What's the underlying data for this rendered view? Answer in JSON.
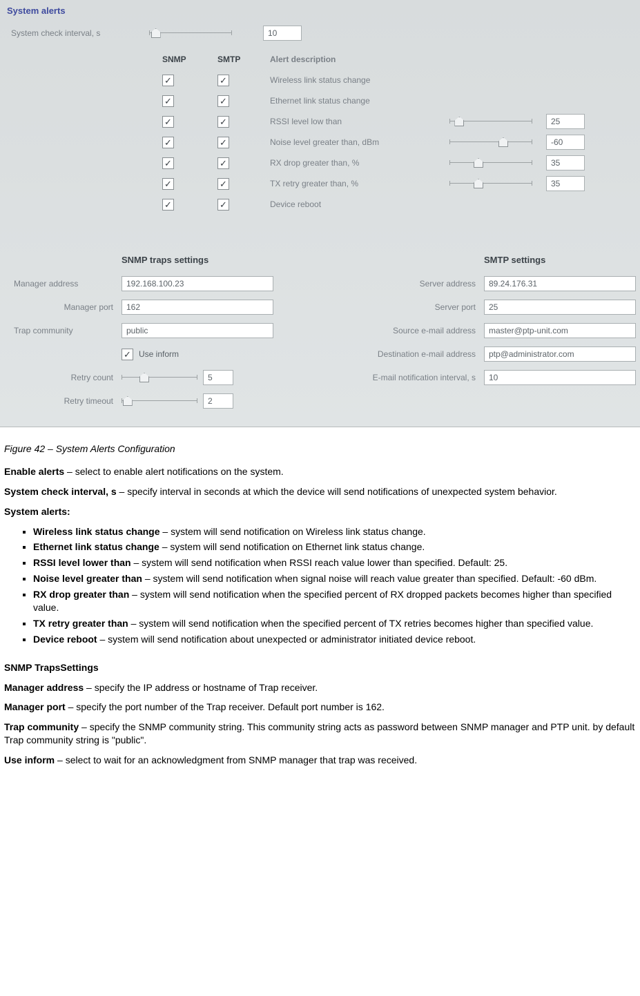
{
  "screenshot": {
    "section_title": "System alerts",
    "interval_label": "System check interval, s",
    "interval_value": "10",
    "headers": {
      "snmp": "SNMP",
      "smtp": "SMTP",
      "desc": "Alert description"
    },
    "alerts": [
      {
        "desc": "Wireless link status change",
        "snmp": true,
        "smtp": true
      },
      {
        "desc": "Ethernet link status change",
        "snmp": true,
        "smtp": true
      },
      {
        "desc": "RSSI level low than",
        "snmp": true,
        "smtp": true,
        "value": "25",
        "pos": 12
      },
      {
        "desc": "Noise level greater than, dBm",
        "snmp": true,
        "smtp": true,
        "value": "-60",
        "pos": 65
      },
      {
        "desc": "RX drop greater than, %",
        "snmp": true,
        "smtp": true,
        "value": "35",
        "pos": 35
      },
      {
        "desc": "TX retry greater than, %",
        "snmp": true,
        "smtp": true,
        "value": "35",
        "pos": 35
      },
      {
        "desc": "Device reboot",
        "snmp": true,
        "smtp": true
      }
    ],
    "snmp_traps": {
      "header": "SNMP traps settings",
      "manager_address_label": "Manager address",
      "manager_address_value": "192.168.100.23",
      "manager_port_label": "Manager port",
      "manager_port_value": "162",
      "trap_community_label": "Trap community",
      "trap_community_value": "public",
      "use_inform_label": "Use inform",
      "use_inform_checked": true,
      "retry_count_label": "Retry count",
      "retry_count_value": "5",
      "retry_timeout_label": "Retry timeout",
      "retry_timeout_value": "2"
    },
    "smtp": {
      "header": "SMTP settings",
      "server_address_label": "Server address",
      "server_address_value": "89.24.176.31",
      "server_port_label": "Server port",
      "server_port_value": "25",
      "source_email_label": "Source e-mail address",
      "source_email_value": "master@ptp-unit.com",
      "dest_email_label": "Destination e-mail address",
      "dest_email_value": "ptp@administrator.com",
      "notif_interval_label": "E-mail notification interval, s",
      "notif_interval_value": "10"
    }
  },
  "doc": {
    "caption": "Figure 42 – System Alerts Configuration",
    "enable_alerts_b": "Enable alerts",
    "enable_alerts_t": " – select to enable alert notifications on the system.",
    "system_check_b": "System check interval, s",
    "system_check_t": " – specify interval in seconds at which the device will send notifications of unexpected system behavior.",
    "system_alerts_header": "System alerts:",
    "bullets": [
      {
        "b": "Wireless link status change",
        "t": " – system will send notification on Wireless link status change."
      },
      {
        "b": "Ethernet link status change",
        "t": " – system will send notification on Ethernet link status change."
      },
      {
        "b": "RSSI level lower than",
        "t": " – system will send notification when RSSI reach value lower than specified. Default: 25."
      },
      {
        "b": "Noise level greater than",
        "t": " – system will send notification when signal noise will reach value greater than specified. Default: -60 dBm."
      },
      {
        "b": "RX drop greater than",
        "t": " – system will send notification when the specified percent of RX dropped packets becomes higher than specified value."
      },
      {
        "b": "TX retry greater than",
        "t": " – system will send notification when the specified percent of TX retries becomes higher than specified value."
      },
      {
        "b": "Device reboot",
        "t": " – system will send notification about unexpected or administrator initiated device reboot."
      }
    ],
    "snmp_header": "SNMP TrapsSettings",
    "manager_addr_b": "Manager address",
    "manager_addr_t": " – specify the IP address or hostname of Trap receiver.",
    "manager_port_b": "Manager port",
    "manager_port_t": " – specify the port number of the Trap receiver. Default port number is 162.",
    "trap_comm_b": "Trap community",
    "trap_comm_t": " – specify the SNMP community string. This community string acts as password between SNMP manager and PTP unit. by default Trap community string is \"public\".",
    "use_inform_b": "Use inform",
    "use_inform_t": " – select to wait for an acknowledgment from SNMP manager that trap was received."
  }
}
